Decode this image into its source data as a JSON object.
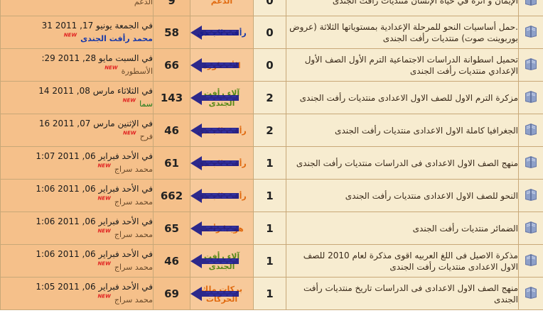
{
  "rows": [
    {
      "last_line1": "",
      "last_line2": "الدعم",
      "views": "9",
      "author": "الدعم",
      "author_color": "orange",
      "replies": "0",
      "title": "الإيمان و أثره في حياة الإنسان منتديات رأفت الجندى",
      "arrow": false,
      "poster_color": "",
      "new": true
    },
    {
      "last_line1": "في الجمعة يونيو 17, 2011 31",
      "last_line2": "محمد رأفت الجندى",
      "views": "58",
      "author": "رأفت الجندى",
      "author_color": "blue",
      "replies": "0",
      "title": ".حمل أساسيات النحو للمرحلة الإعدادية بمستوياتها الثلاثة (عروض بوربوينت صوت) منتديات رأفت الجندى",
      "arrow": true,
      "poster_color": "blue",
      "new": true
    },
    {
      "last_line1": "في السبت مايو 28, 2011 29:",
      "last_line2": "الأسطورة",
      "views": "66",
      "author": "الأسطورة",
      "author_color": "orange",
      "replies": "0",
      "title": "تحميل اسطوانة الدراسات الاجتماعية الترم الأول الصف الأول الإعدادي منتديات رأفت الجندى",
      "arrow": true,
      "poster_color": "",
      "new": true
    },
    {
      "last_line1": "في الثلاثاء مارس 08, 2011 14",
      "last_line2": "سما",
      "views": "143",
      "author": "آلاء رأفت الجندى",
      "author_color": "green",
      "replies": "2",
      "title": "مزكرة الترم الاول للصف الاول الاعدادى منتديات رأفت الجندى",
      "arrow": true,
      "poster_color": "green",
      "new": true
    },
    {
      "last_line1": "في الإثنين مارس 07, 2011 16",
      "last_line2": "فرح",
      "views": "46",
      "author": "رأفت الجندى",
      "author_color": "orange",
      "replies": "2",
      "title": "الجغرافيا كاملة الاول الاعدادى منتديات رأفت الجندى",
      "arrow": true,
      "poster_color": "",
      "new": true
    },
    {
      "last_line1": "في الأحد فبراير 06, 2011 1:07",
      "last_line2": "محمد سراج",
      "views": "61",
      "author": "رأفت الجندى",
      "author_color": "orange",
      "replies": "1",
      "title": "منهج الصف الاول الاعدادى فى الدراسات منتديات رأفت الجندى",
      "arrow": true,
      "poster_color": "",
      "new": true
    },
    {
      "last_line1": "في الأحد فبراير 06, 2011 1:06",
      "last_line2": "محمد سراج",
      "views": "662",
      "author": "رأفت الجندى",
      "author_color": "orange",
      "replies": "1",
      "title": "النحو للصف الاول الاعدادى منتديات رأفت الجندى",
      "arrow": true,
      "poster_color": "",
      "new": true
    },
    {
      "last_line1": "في الأحد فبراير 06, 2011 1:06",
      "last_line2": "محمد سراج",
      "views": "65",
      "author": "هويدا رأفت",
      "author_color": "orange",
      "replies": "1",
      "title": "الضمائر منتديات رأفت الجندى",
      "arrow": true,
      "poster_color": "",
      "new": true
    },
    {
      "last_line1": "في الأحد فبراير 06, 2011 1:06",
      "last_line2": "محمد سراج",
      "views": "46",
      "author": "آلاء رأفت الجندى",
      "author_color": "green",
      "replies": "1",
      "title": "مذكرة الاصيل فى اللغ العربيه اقوى مذكرة لعام 2010 للصف الاول الاعدادى منتديات رأفت الجندى",
      "arrow": true,
      "poster_color": "",
      "new": true
    },
    {
      "last_line1": "في الأحد فبراير 06, 2011 1:05",
      "last_line2": "محمد سراج",
      "views": "69",
      "author": "بركات ملك الحركات",
      "author_color": "orange",
      "replies": "1",
      "title": "منهج الصف الاول الاعدادى فى الدراسات تاريخ منتديات رأفت الجندى",
      "arrow": true,
      "poster_color": "",
      "new": true
    }
  ],
  "new_badge": "NEW",
  "colors": {
    "row_bg": "#f7ecd0",
    "orange_col": "#f5c08a",
    "border": "#c8a878",
    "arrow": "#1a1a8a"
  }
}
